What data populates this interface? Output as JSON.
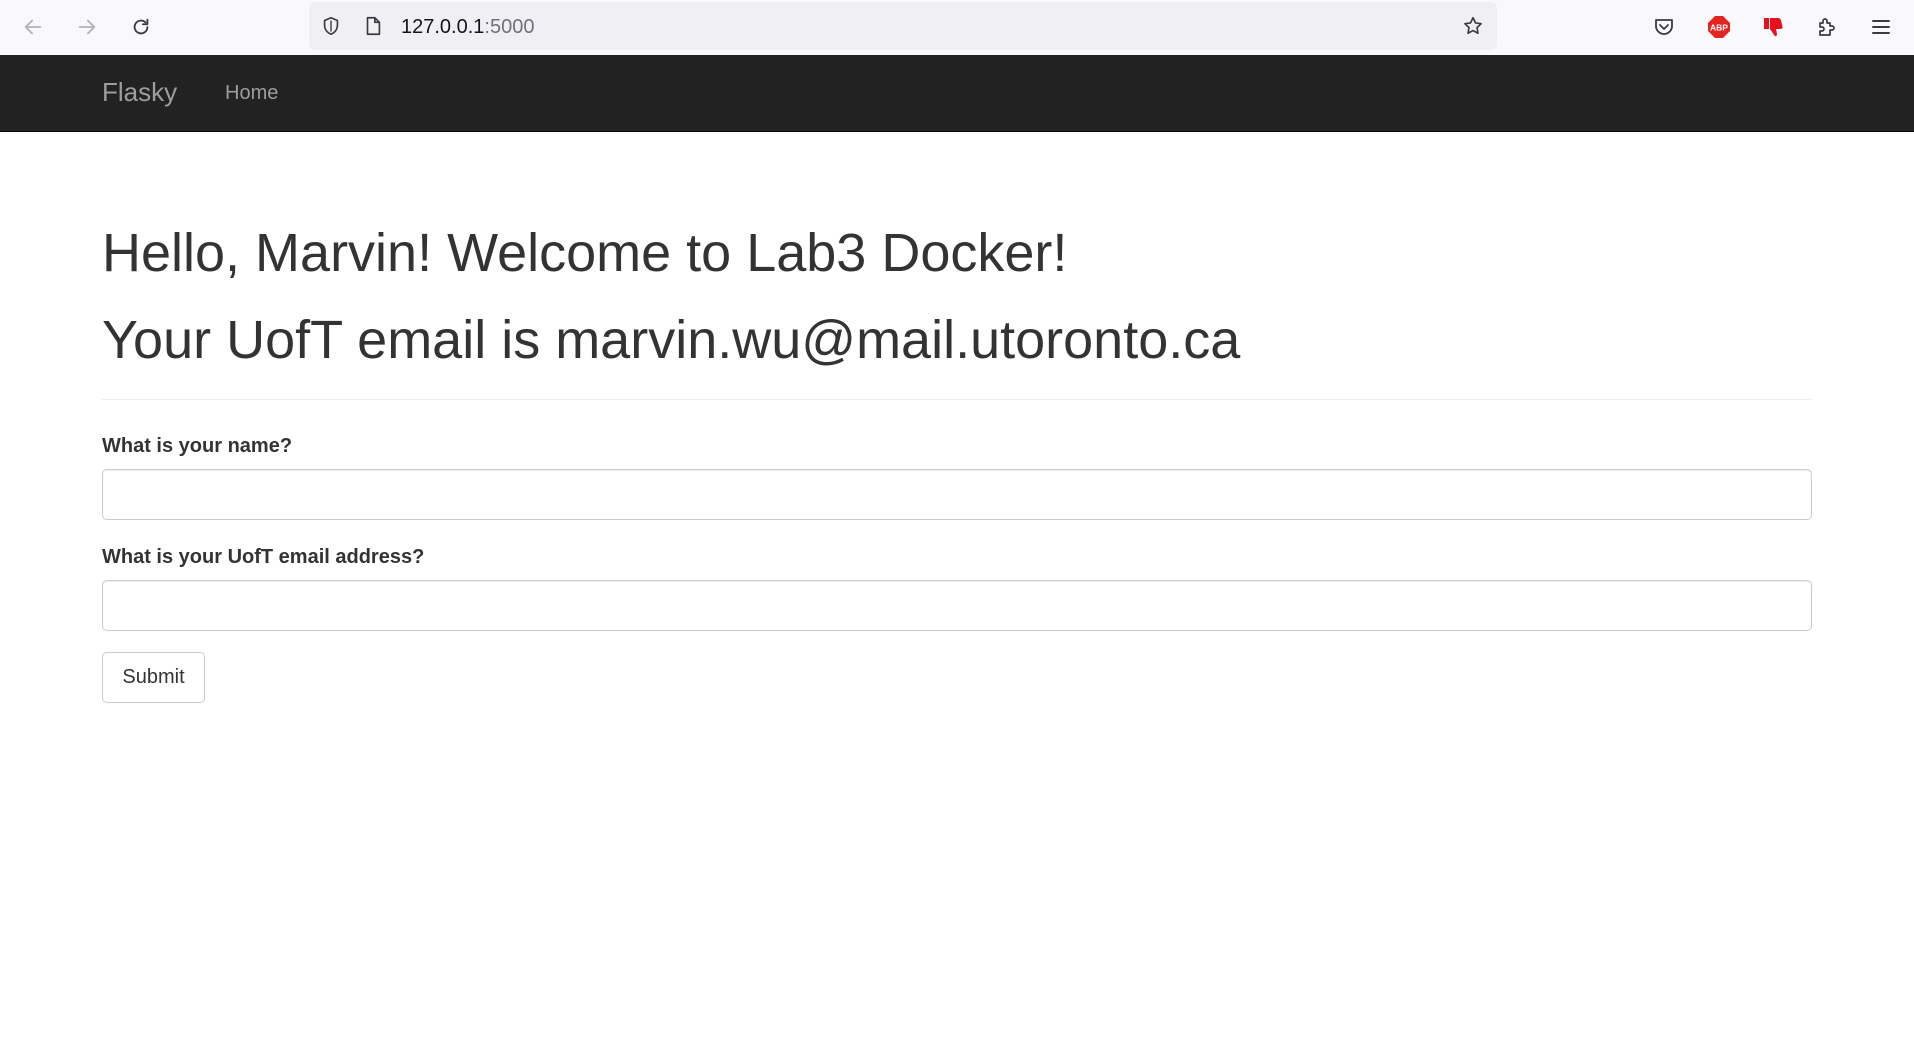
{
  "browser": {
    "url_host": "127.0.0.1",
    "url_port": ":5000",
    "icons": {
      "back": "arrow-left-icon",
      "forward": "arrow-right-icon",
      "reload": "reload-icon",
      "tracking": "shield-icon",
      "page": "page-icon",
      "bookmark": "star-icon",
      "pocket": "pocket-icon",
      "adblock": "abp-icon",
      "extension": "thumb-down-icon",
      "extensions": "puzzle-icon",
      "menu": "hamburger-icon"
    },
    "adblock_label": "ABP",
    "colors": {
      "adblock": "#e52421",
      "extension": "#e8101c"
    }
  },
  "navbar": {
    "brand": "Flasky",
    "home": "Home"
  },
  "main": {
    "greeting": "Hello, Marvin! Welcome to Lab3 Docker!",
    "email_line": "Your UofT email is marvin.wu@mail.utoronto.ca",
    "form": {
      "name_label": "What is your name?",
      "name_value": "",
      "email_label": "What is your UofT email address?",
      "email_value": "",
      "submit_label": "Submit"
    }
  }
}
